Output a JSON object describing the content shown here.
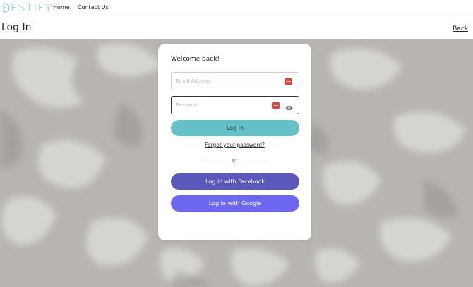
{
  "nav": {
    "logo_text": "ESTIFY",
    "items": [
      {
        "label": "Home"
      },
      {
        "label": "Contact Us"
      }
    ]
  },
  "header": {
    "title": "Log In",
    "back_label": "Back"
  },
  "login_card": {
    "greeting": "Welcome back!",
    "email": {
      "placeholder": "Email Address",
      "value": ""
    },
    "password": {
      "placeholder": "Password",
      "value": ""
    },
    "login_button": "Log in",
    "forgot_link": "Forgot your password?",
    "divider_text": "or",
    "facebook_button": "Log in with Facebook",
    "google_button": "Log in with Google"
  },
  "colors": {
    "brand": "#6fc6cf",
    "login_button": "#66c0c8",
    "facebook_button": "#5a58bb",
    "google_button": "#6c67ee",
    "field_icon": "#d2453b"
  },
  "icons": [
    "logo-mark-icon",
    "field-badge-icon",
    "eye-icon"
  ]
}
